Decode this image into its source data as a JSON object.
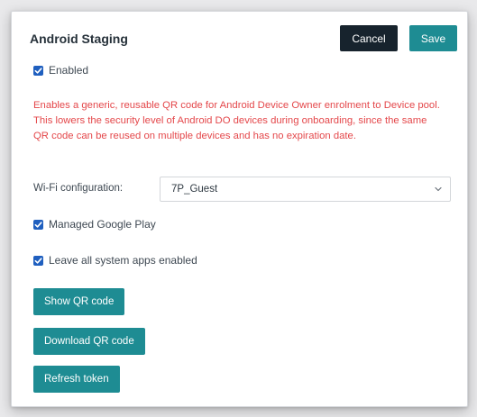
{
  "panel": {
    "title": "Android Staging",
    "cancel_label": "Cancel",
    "save_label": "Save"
  },
  "enabled": {
    "label": "Enabled",
    "checked": true
  },
  "warning_text": "Enables a generic, reusable QR code for Android Device Owner enrolment to Device pool. This lowers the security level of Android DO devices during onboarding, since the same QR code can be reused on multiple devices and has no expiration date.",
  "wifi": {
    "label": "Wi-Fi configuration:",
    "value": "7P_Guest"
  },
  "managed_play": {
    "label": "Managed Google Play",
    "checked": true
  },
  "system_apps": {
    "label": "Leave all system apps enabled",
    "checked": true
  },
  "actions": {
    "show_qr": "Show QR code",
    "download_qr": "Download QR code",
    "refresh_token": "Refresh token"
  },
  "colors": {
    "accent": "#1e8c93",
    "dark_button": "#17232d",
    "warning": "#e4474a",
    "checkbox": "#1f5fbf"
  },
  "icons": [
    "check-icon",
    "chevron-down-icon"
  ]
}
